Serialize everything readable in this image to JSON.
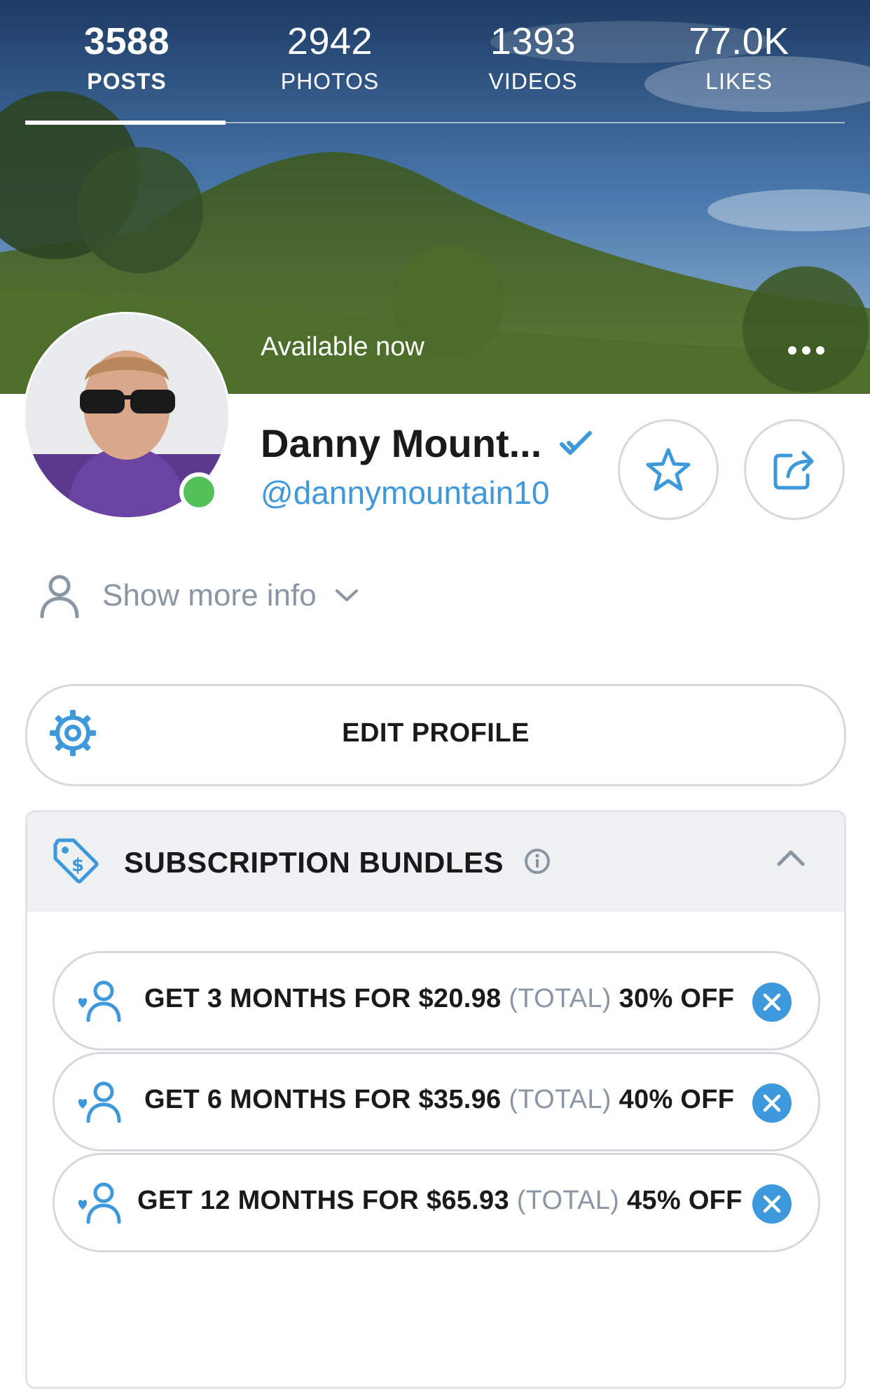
{
  "stats": [
    {
      "value": "3588",
      "label": "POSTS"
    },
    {
      "value": "2942",
      "label": "PHOTOS"
    },
    {
      "value": "1393",
      "label": "VIDEOS"
    },
    {
      "value": "77.0K",
      "label": "LIKES"
    }
  ],
  "cover": {
    "status": "Available now"
  },
  "profile": {
    "name": "Danny Mount...",
    "handle": "@dannymountain10"
  },
  "show_more": "Show more info",
  "edit_profile": "EDIT PROFILE",
  "bundles": {
    "title": "SUBSCRIPTION BUNDLES",
    "items": [
      {
        "prefix": "GET 3 MONTHS FOR $20.98",
        "total": "(TOTAL)",
        "discount": "30% OFF"
      },
      {
        "prefix": "GET 6 MONTHS FOR $35.96",
        "total": "(TOTAL)",
        "discount": "40% OFF"
      },
      {
        "prefix": "GET 12 MONTHS FOR $65.93",
        "total": "(TOTAL)",
        "discount": "45% OFF"
      }
    ]
  },
  "colors": {
    "accent": "#3d98dc",
    "online": "#52c15a",
    "muted": "#8a96a3",
    "border": "#d5d9de",
    "header_bg": "#eef0f2"
  },
  "icons": [
    "more-dots-icon",
    "verified-check-icon",
    "star-icon",
    "share-icon",
    "user-icon",
    "chevron-down-icon",
    "gear-icon",
    "price-tag-icon",
    "info-icon",
    "chevron-up-icon",
    "user-heart-icon",
    "close-icon"
  ]
}
